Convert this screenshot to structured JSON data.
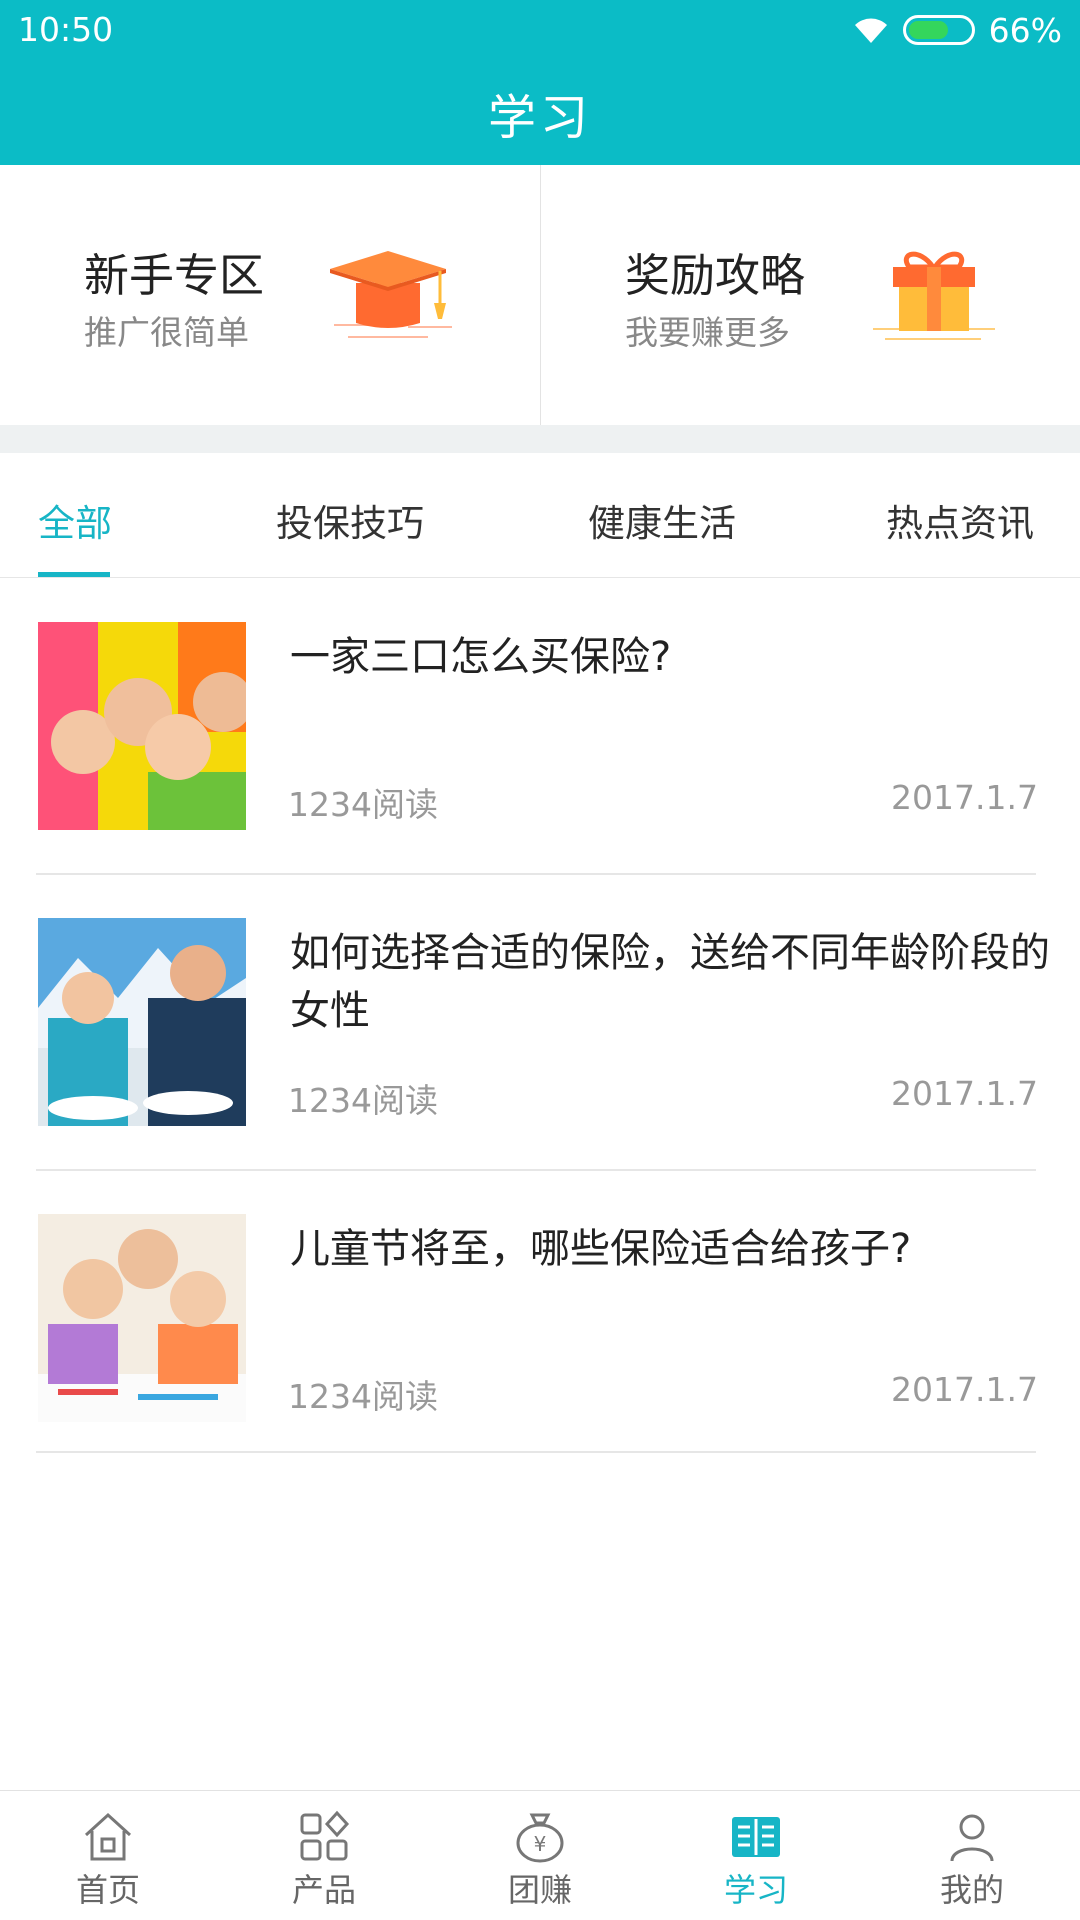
{
  "status_bar": {
    "time": "10:50",
    "battery": "66%"
  },
  "header": {
    "title": "学习"
  },
  "promo": [
    {
      "title": "新手专区",
      "subtitle": "推广很简单",
      "icon": "graduation-cap-icon"
    },
    {
      "title": "奖励攻略",
      "subtitle": "我要赚更多",
      "icon": "gift-icon"
    }
  ],
  "tabs": [
    {
      "label": "全部",
      "active": true
    },
    {
      "label": "投保技巧",
      "active": false
    },
    {
      "label": "健康生活",
      "active": false
    },
    {
      "label": "热点资讯",
      "active": false
    }
  ],
  "articles": [
    {
      "title": "一家三口怎么买保险?",
      "reads": "1234阅读",
      "date": "2017.1.7"
    },
    {
      "title": "如何选择合适的保险，送给不同年龄阶段的女性",
      "reads": "1234阅读",
      "date": "2017.1.7"
    },
    {
      "title": "儿童节将至，哪些保险适合给孩子?",
      "reads": "1234阅读",
      "date": "2017.1.7"
    }
  ],
  "bottom_nav": [
    {
      "label": "首页",
      "icon": "home-icon",
      "active": false
    },
    {
      "label": "产品",
      "icon": "products-grid-icon",
      "active": false
    },
    {
      "label": "团赚",
      "icon": "money-bag-icon",
      "active": false
    },
    {
      "label": "学习",
      "icon": "book-icon",
      "active": true
    },
    {
      "label": "我的",
      "icon": "user-icon",
      "active": false
    }
  ],
  "colors": {
    "brand": "#0bbcc6",
    "accent": "#17b5c6",
    "cap": "#ff6a30",
    "gift": "#ffbc3a"
  }
}
